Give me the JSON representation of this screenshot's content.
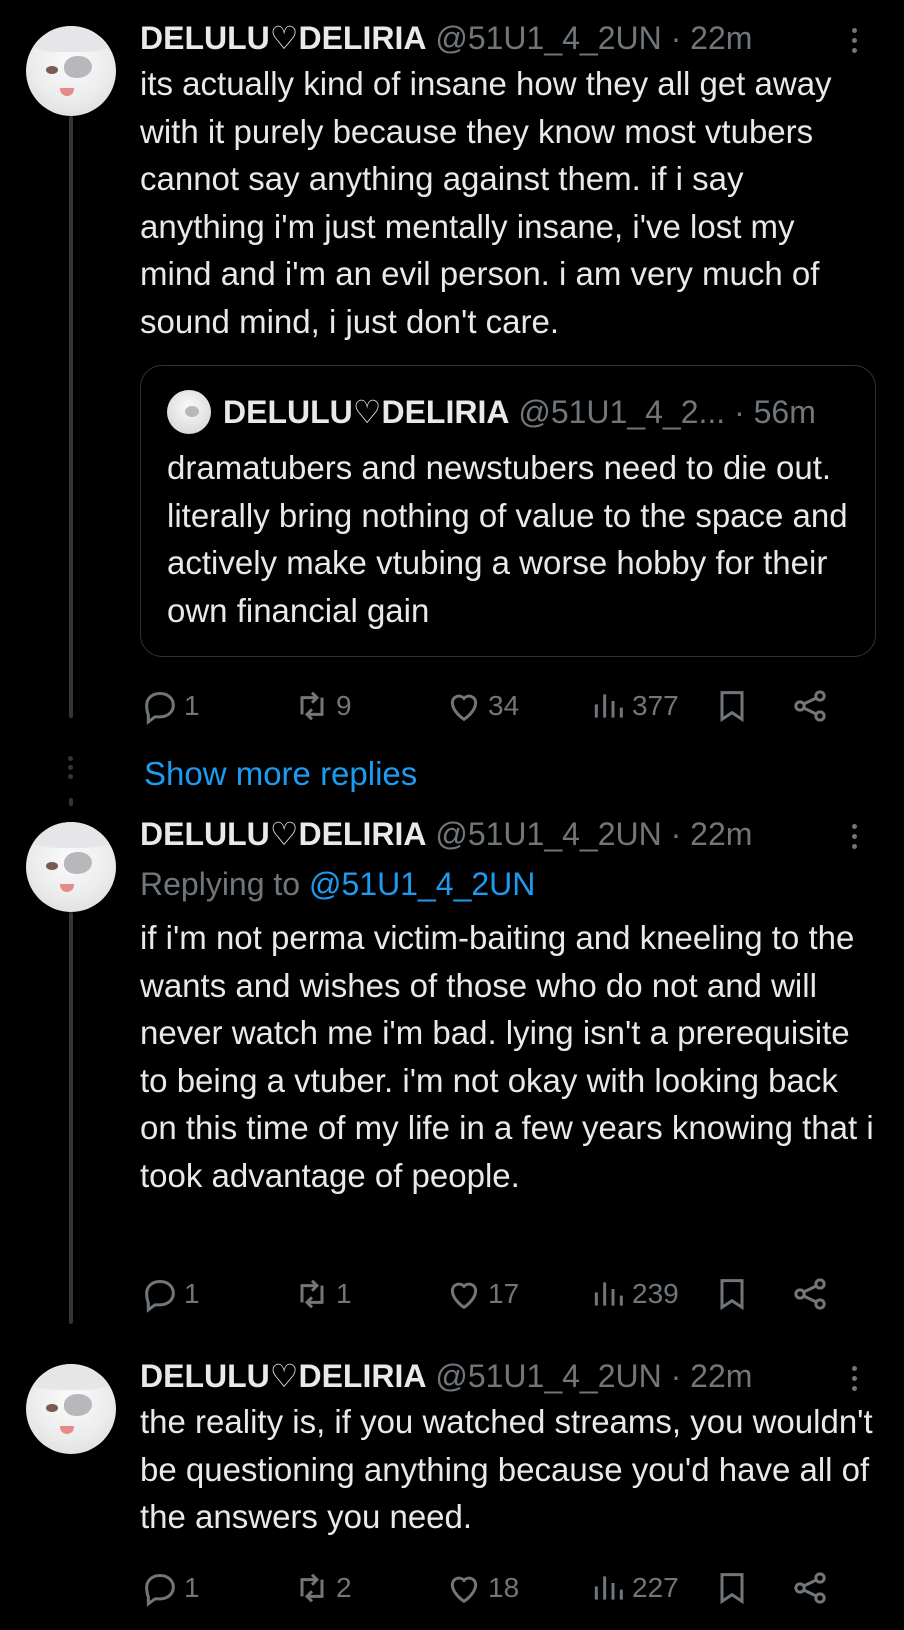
{
  "tweets": [
    {
      "name": "DELULU♡DELIRIA",
      "handle": "@51U1_4_2UN",
      "dot": "·",
      "time": "22m",
      "text": "its actually kind of insane how they all get away with it purely because they know most vtubers cannot say anything against them. if i say anything i'm just mentally insane, i've lost my mind and i'm an evil person. i am very much of sound mind, i just don't care.",
      "quote": {
        "name": "DELULU♡DELIRIA",
        "handle": "@51U1_4_2...",
        "dot": "·",
        "time": "56m",
        "text": "dramatubers and newstubers need to die out. literally bring nothing of value to the space and actively make vtubing a worse hobby for their own financial gain"
      },
      "stats": {
        "replies": "1",
        "reposts": "9",
        "likes": "34",
        "views": "377"
      }
    },
    {
      "name": "DELULU♡DELIRIA",
      "handle": "@51U1_4_2UN",
      "dot": "·",
      "time": "22m",
      "replying_label": "Replying to",
      "replying_handle": "@51U1_4_2UN",
      "text": "if i'm not perma victim-baiting and kneeling to the wants and wishes of those who do not and will never watch me i'm bad. lying isn't a prerequisite to being a vtuber. i'm not okay with looking back on this time of my life in a few years knowing that i took advantage of people.",
      "stats": {
        "replies": "1",
        "reposts": "1",
        "likes": "17",
        "views": "239"
      }
    },
    {
      "name": "DELULU♡DELIRIA",
      "handle": "@51U1_4_2UN",
      "dot": "·",
      "time": "22m",
      "text": "the reality is, if you watched streams, you wouldn't be questioning anything because you'd have all of the answers you need.",
      "stats": {
        "replies": "1",
        "reposts": "2",
        "likes": "18",
        "views": "227"
      }
    }
  ],
  "show_more_replies": "Show more replies",
  "icons": {
    "reply": "reply-icon",
    "repost": "repost-icon",
    "like": "heart-icon",
    "views": "views-icon",
    "bookmark": "bookmark-icon",
    "share": "share-icon",
    "more": "more-vertical-icon"
  },
  "colors": {
    "background": "#000000",
    "text": "#e7e9ea",
    "muted": "#71767b",
    "link": "#1d9bf0",
    "border": "#2f3336"
  }
}
